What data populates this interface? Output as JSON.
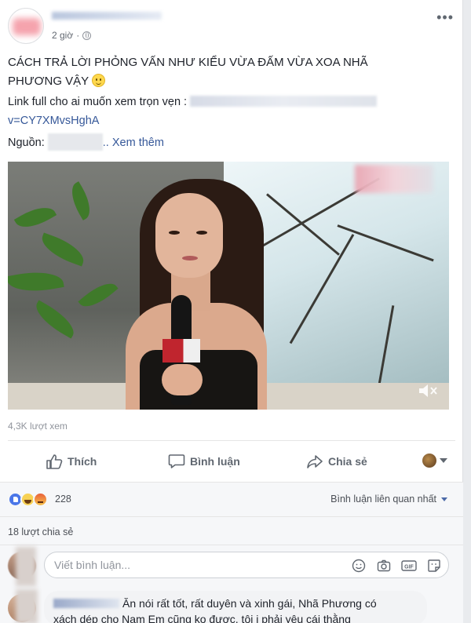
{
  "post": {
    "time": "2 giờ",
    "privacy_dot": "·",
    "more_label": "•••",
    "text_line1": "CÁCH TRẢ LỜI PHỎNG VẤN NHƯ KIỂU VỪA ĐẤM VỪA XOA NHÃ",
    "text_line2": "PHƯƠNG VẬY",
    "link_label": "Link full cho ai muốn xem trọn vẹn :",
    "link_tail": "v=CY7XMvsHghA",
    "source_label": "Nguồn:",
    "see_more": ".. Xem thêm"
  },
  "video": {
    "views": "4,3K lượt xem"
  },
  "actions": {
    "like": "Thích",
    "comment": "Bình luận",
    "share": "Chia sẻ"
  },
  "reactions": {
    "count": "228",
    "sort_label": "Bình luận liên quan nhất"
  },
  "shares": {
    "text": "18 lượt chia sẻ"
  },
  "comment_input": {
    "placeholder": "Viết bình luận..."
  },
  "comments": [
    {
      "line1": "Ăn nói rất tốt, rất duyên và xinh gái, Nhã Phương có",
      "line2": "xách dép cho Nam Em cũng ko được, tôi ị phải yêu cái thằng"
    }
  ],
  "colors": {
    "link": "#365899",
    "like_blue": "#4a76e8",
    "muted": "#90949c"
  }
}
